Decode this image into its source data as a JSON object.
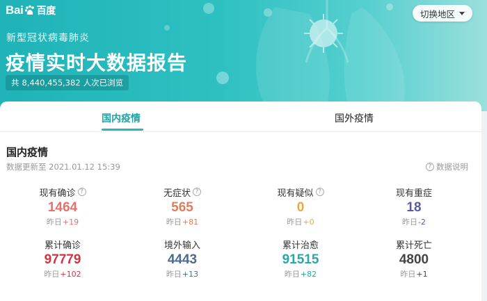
{
  "header": {
    "logo_text_left": "Bai",
    "logo_text_mid": "du",
    "logo_text_right": "百度",
    "subtitle": "新型冠状病毒肺炎",
    "title": "疫情实时大数据报告",
    "views_prefix": "共",
    "views_count": "8,440,455,382",
    "views_suffix": "人次已浏览",
    "region_button": "切换地区",
    "colors": {
      "banner_start": "#1fb3b8",
      "banner_end": "#9be0dd"
    }
  },
  "tabs": [
    {
      "label": "国内疫情",
      "active": true
    },
    {
      "label": "国外疫情",
      "active": false
    }
  ],
  "section": {
    "title": "国内疫情",
    "update_label": "数据更新至 2021.01.12 15:39",
    "data_note": "数据说明"
  },
  "stats": [
    {
      "label": "现有确诊",
      "help": true,
      "value": "1464",
      "delta_label": "昨日",
      "delta": "+19",
      "color": "#e8706a"
    },
    {
      "label": "无症状",
      "help": true,
      "value": "565",
      "delta_label": "昨日",
      "delta": "+81",
      "color": "#e27d5c"
    },
    {
      "label": "现有疑似",
      "help": true,
      "value": "0",
      "delta_label": "昨日",
      "delta": "+0",
      "color": "#eba73f"
    },
    {
      "label": "现有重症",
      "help": false,
      "value": "18",
      "delta_label": "昨日",
      "delta": "-2",
      "color": "#5c5a98"
    },
    {
      "label": "累计确诊",
      "help": false,
      "value": "97779",
      "delta_label": "昨日",
      "delta": "+102",
      "color": "#d4343f"
    },
    {
      "label": "境外输入",
      "help": false,
      "value": "4443",
      "delta_label": "昨日",
      "delta": "+13",
      "color": "#4a6a8e"
    },
    {
      "label": "累计治愈",
      "help": false,
      "value": "91515",
      "delta_label": "昨日",
      "delta": "+82",
      "color": "#2aa8a8"
    },
    {
      "label": "累计死亡",
      "help": false,
      "value": "4800",
      "delta_label": "昨日",
      "delta": "+1",
      "color": "#444444"
    }
  ]
}
